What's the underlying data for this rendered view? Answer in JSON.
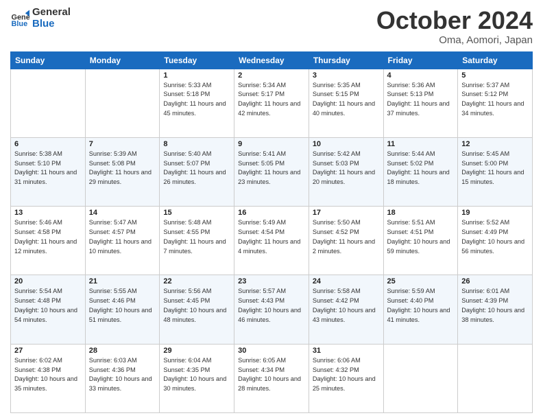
{
  "logo": {
    "text_general": "General",
    "text_blue": "Blue"
  },
  "header": {
    "month": "October 2024",
    "location": "Oma, Aomori, Japan"
  },
  "weekdays": [
    "Sunday",
    "Monday",
    "Tuesday",
    "Wednesday",
    "Thursday",
    "Friday",
    "Saturday"
  ],
  "weeks": [
    [
      {
        "day": "",
        "sunrise": "",
        "sunset": "",
        "daylight": ""
      },
      {
        "day": "",
        "sunrise": "",
        "sunset": "",
        "daylight": ""
      },
      {
        "day": "1",
        "sunrise": "Sunrise: 5:33 AM",
        "sunset": "Sunset: 5:18 PM",
        "daylight": "Daylight: 11 hours and 45 minutes."
      },
      {
        "day": "2",
        "sunrise": "Sunrise: 5:34 AM",
        "sunset": "Sunset: 5:17 PM",
        "daylight": "Daylight: 11 hours and 42 minutes."
      },
      {
        "day": "3",
        "sunrise": "Sunrise: 5:35 AM",
        "sunset": "Sunset: 5:15 PM",
        "daylight": "Daylight: 11 hours and 40 minutes."
      },
      {
        "day": "4",
        "sunrise": "Sunrise: 5:36 AM",
        "sunset": "Sunset: 5:13 PM",
        "daylight": "Daylight: 11 hours and 37 minutes."
      },
      {
        "day": "5",
        "sunrise": "Sunrise: 5:37 AM",
        "sunset": "Sunset: 5:12 PM",
        "daylight": "Daylight: 11 hours and 34 minutes."
      }
    ],
    [
      {
        "day": "6",
        "sunrise": "Sunrise: 5:38 AM",
        "sunset": "Sunset: 5:10 PM",
        "daylight": "Daylight: 11 hours and 31 minutes."
      },
      {
        "day": "7",
        "sunrise": "Sunrise: 5:39 AM",
        "sunset": "Sunset: 5:08 PM",
        "daylight": "Daylight: 11 hours and 29 minutes."
      },
      {
        "day": "8",
        "sunrise": "Sunrise: 5:40 AM",
        "sunset": "Sunset: 5:07 PM",
        "daylight": "Daylight: 11 hours and 26 minutes."
      },
      {
        "day": "9",
        "sunrise": "Sunrise: 5:41 AM",
        "sunset": "Sunset: 5:05 PM",
        "daylight": "Daylight: 11 hours and 23 minutes."
      },
      {
        "day": "10",
        "sunrise": "Sunrise: 5:42 AM",
        "sunset": "Sunset: 5:03 PM",
        "daylight": "Daylight: 11 hours and 20 minutes."
      },
      {
        "day": "11",
        "sunrise": "Sunrise: 5:44 AM",
        "sunset": "Sunset: 5:02 PM",
        "daylight": "Daylight: 11 hours and 18 minutes."
      },
      {
        "day": "12",
        "sunrise": "Sunrise: 5:45 AM",
        "sunset": "Sunset: 5:00 PM",
        "daylight": "Daylight: 11 hours and 15 minutes."
      }
    ],
    [
      {
        "day": "13",
        "sunrise": "Sunrise: 5:46 AM",
        "sunset": "Sunset: 4:58 PM",
        "daylight": "Daylight: 11 hours and 12 minutes."
      },
      {
        "day": "14",
        "sunrise": "Sunrise: 5:47 AM",
        "sunset": "Sunset: 4:57 PM",
        "daylight": "Daylight: 11 hours and 10 minutes."
      },
      {
        "day": "15",
        "sunrise": "Sunrise: 5:48 AM",
        "sunset": "Sunset: 4:55 PM",
        "daylight": "Daylight: 11 hours and 7 minutes."
      },
      {
        "day": "16",
        "sunrise": "Sunrise: 5:49 AM",
        "sunset": "Sunset: 4:54 PM",
        "daylight": "Daylight: 11 hours and 4 minutes."
      },
      {
        "day": "17",
        "sunrise": "Sunrise: 5:50 AM",
        "sunset": "Sunset: 4:52 PM",
        "daylight": "Daylight: 11 hours and 2 minutes."
      },
      {
        "day": "18",
        "sunrise": "Sunrise: 5:51 AM",
        "sunset": "Sunset: 4:51 PM",
        "daylight": "Daylight: 10 hours and 59 minutes."
      },
      {
        "day": "19",
        "sunrise": "Sunrise: 5:52 AM",
        "sunset": "Sunset: 4:49 PM",
        "daylight": "Daylight: 10 hours and 56 minutes."
      }
    ],
    [
      {
        "day": "20",
        "sunrise": "Sunrise: 5:54 AM",
        "sunset": "Sunset: 4:48 PM",
        "daylight": "Daylight: 10 hours and 54 minutes."
      },
      {
        "day": "21",
        "sunrise": "Sunrise: 5:55 AM",
        "sunset": "Sunset: 4:46 PM",
        "daylight": "Daylight: 10 hours and 51 minutes."
      },
      {
        "day": "22",
        "sunrise": "Sunrise: 5:56 AM",
        "sunset": "Sunset: 4:45 PM",
        "daylight": "Daylight: 10 hours and 48 minutes."
      },
      {
        "day": "23",
        "sunrise": "Sunrise: 5:57 AM",
        "sunset": "Sunset: 4:43 PM",
        "daylight": "Daylight: 10 hours and 46 minutes."
      },
      {
        "day": "24",
        "sunrise": "Sunrise: 5:58 AM",
        "sunset": "Sunset: 4:42 PM",
        "daylight": "Daylight: 10 hours and 43 minutes."
      },
      {
        "day": "25",
        "sunrise": "Sunrise: 5:59 AM",
        "sunset": "Sunset: 4:40 PM",
        "daylight": "Daylight: 10 hours and 41 minutes."
      },
      {
        "day": "26",
        "sunrise": "Sunrise: 6:01 AM",
        "sunset": "Sunset: 4:39 PM",
        "daylight": "Daylight: 10 hours and 38 minutes."
      }
    ],
    [
      {
        "day": "27",
        "sunrise": "Sunrise: 6:02 AM",
        "sunset": "Sunset: 4:38 PM",
        "daylight": "Daylight: 10 hours and 35 minutes."
      },
      {
        "day": "28",
        "sunrise": "Sunrise: 6:03 AM",
        "sunset": "Sunset: 4:36 PM",
        "daylight": "Daylight: 10 hours and 33 minutes."
      },
      {
        "day": "29",
        "sunrise": "Sunrise: 6:04 AM",
        "sunset": "Sunset: 4:35 PM",
        "daylight": "Daylight: 10 hours and 30 minutes."
      },
      {
        "day": "30",
        "sunrise": "Sunrise: 6:05 AM",
        "sunset": "Sunset: 4:34 PM",
        "daylight": "Daylight: 10 hours and 28 minutes."
      },
      {
        "day": "31",
        "sunrise": "Sunrise: 6:06 AM",
        "sunset": "Sunset: 4:32 PM",
        "daylight": "Daylight: 10 hours and 25 minutes."
      },
      {
        "day": "",
        "sunrise": "",
        "sunset": "",
        "daylight": ""
      },
      {
        "day": "",
        "sunrise": "",
        "sunset": "",
        "daylight": ""
      }
    ]
  ]
}
